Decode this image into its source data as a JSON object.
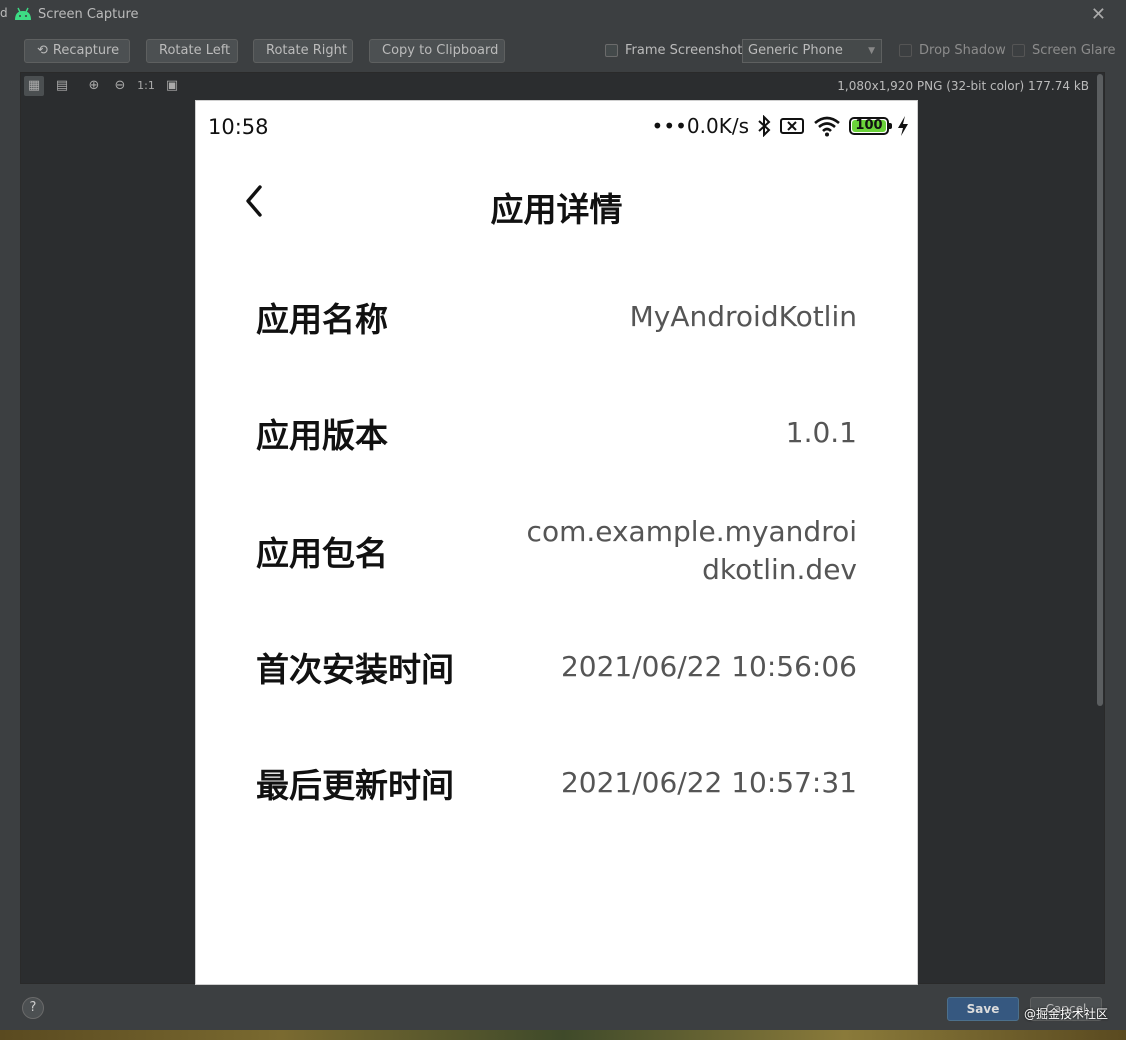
{
  "window": {
    "title": "Screen Capture",
    "close_glyph": "✕",
    "left_edge_char": "d"
  },
  "toolbar": {
    "recapture": "Recapture",
    "rotate_left": "Rotate Left",
    "rotate_right": "Rotate Right",
    "copy_clipboard": "Copy to Clipboard",
    "frame_screenshot": "Frame Screenshot",
    "device": "Generic Phone",
    "drop_shadow": "Drop Shadow",
    "screen_glare": "Screen Glare"
  },
  "viewer": {
    "info": "1,080x1,920 PNG (32-bit color) 177.74 kB",
    "one_to_one": "1:1"
  },
  "phone": {
    "status": {
      "time": "10:58",
      "speed": "•••0.0K/s",
      "battery": "100"
    },
    "title": "应用详情",
    "rows": [
      {
        "label": "应用名称",
        "value": "MyAndroidKotlin"
      },
      {
        "label": "应用版本",
        "value": "1.0.1"
      },
      {
        "label": "应用包名",
        "value_line1": "com.example.myandroi",
        "value_line2": "dkotlin.dev"
      },
      {
        "label": "首次安装时间",
        "value": "2021/06/22 10:56:06"
      },
      {
        "label": "最后更新时间",
        "value": "2021/06/22 10:57:31"
      }
    ]
  },
  "footer": {
    "help": "?",
    "save": "Save",
    "cancel": "Cancel",
    "watermark": "@掘金技术社区"
  },
  "colors": {
    "ide_bg": "#3c3f41",
    "primary_button": "#365880",
    "battery_fill": "#6bd33a"
  }
}
